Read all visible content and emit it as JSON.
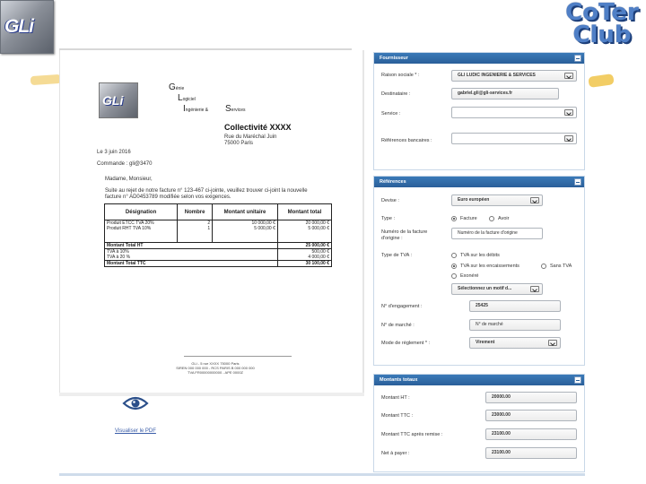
{
  "logos": {
    "gli": "GLi",
    "coter": [
      "CoTer",
      "Club"
    ]
  },
  "document": {
    "company_letters": [
      "G",
      "L",
      "I",
      "S"
    ],
    "company_words": [
      "énie",
      "ogiciel",
      "ngénierie &",
      "ervices"
    ],
    "recipient": "Collectivité XXXX",
    "address": [
      "Rue du Maréchal Juin",
      "75000 Paris"
    ],
    "date_line": "Le 3 juin 2016",
    "order_line": "Commande : gli@3470",
    "greeting": "Madame, Monsieur,",
    "body": [
      "Suite au rejet de notre facture n° 123-467 ci-jointe, veuillez trouver ci-joint la nouvelle",
      "facture n° AD0453789 modifiée selon vos exigences."
    ],
    "table_headers": [
      "Désignation",
      "Nombre",
      "Montant unitaire",
      "Montant total"
    ],
    "rows": [
      [
        "Produit ETCC TVA 20%",
        "2",
        "10 000,00 €",
        "20 000,00 €"
      ],
      [
        "Produit RHT TVA 10%",
        "1",
        "5 000,00 €",
        "5 000,00 €"
      ],
      [
        "",
        "",
        "",
        ""
      ],
      [
        "",
        "",
        "",
        ""
      ]
    ],
    "totals": [
      [
        "Montant Total HT",
        "25 000,00 €"
      ],
      [
        "TVA à 10%",
        "500,00 €"
      ],
      [
        "TVA à 20 %",
        "4 000,00 €"
      ],
      [
        "Montant Total TTC",
        "30 100,00 €"
      ]
    ],
    "footer": [
      "GLi - 5 rue XXXX 75000 Paris",
      "SIREN 000 000 000 - RCS PARIS B 000 000 000",
      "TVA FR00000000000 - APE 0000Z"
    ]
  },
  "view_link": "Visualiser le PDF",
  "fournisseur": {
    "title": "Fournisseur",
    "raison_label": "Raison sociale * :",
    "raison_value": "GLI LUDIC INGENIERIE & SERVICES",
    "destinataire_label": "Destinataire :",
    "destinataire_value": "gabriel.gli@gli-services.fr",
    "service_label": "Service :",
    "references_label": "Références bancaires :"
  },
  "references": {
    "title": "Références",
    "devise_label": "Devise :",
    "devise_value": "Euro européen",
    "type_label": "Type :",
    "type_options": [
      "Facture",
      "Avoir"
    ],
    "numero_label": [
      "Numéro de la facture",
      "d'origine :"
    ],
    "numero_placeholder": "Numéro de la facture d'origine",
    "tva_label": "Type de TVA :",
    "tva_options": [
      "TVA sur les débits",
      "TVA sur les encaissements",
      "Sans TVA",
      "Exonéré"
    ],
    "motif_value": "Sélectionnez un motif d...",
    "engagement_label": "N° d'engagement :",
    "engagement_value": "25425",
    "marche_label": "N° de marché :",
    "marche_placeholder": "N° de marché",
    "mode_label": "Mode de règlement * :",
    "mode_value": "Virement"
  },
  "montants": {
    "title": "Montants totaux",
    "ht_label": "Montant HT :",
    "ht_value": "20000.00",
    "ttc_label": "Montant TTC :",
    "ttc_value": "23000.00",
    "remise_label": "Montant TTC après remise :",
    "remise_value": "23100.00",
    "net_label": "Net à payer :",
    "net_value": "23100.00"
  },
  "colors": {
    "panel_header": "#2a5f99",
    "panel_border": "#c9d8e8",
    "link": "#3a5da8"
  }
}
